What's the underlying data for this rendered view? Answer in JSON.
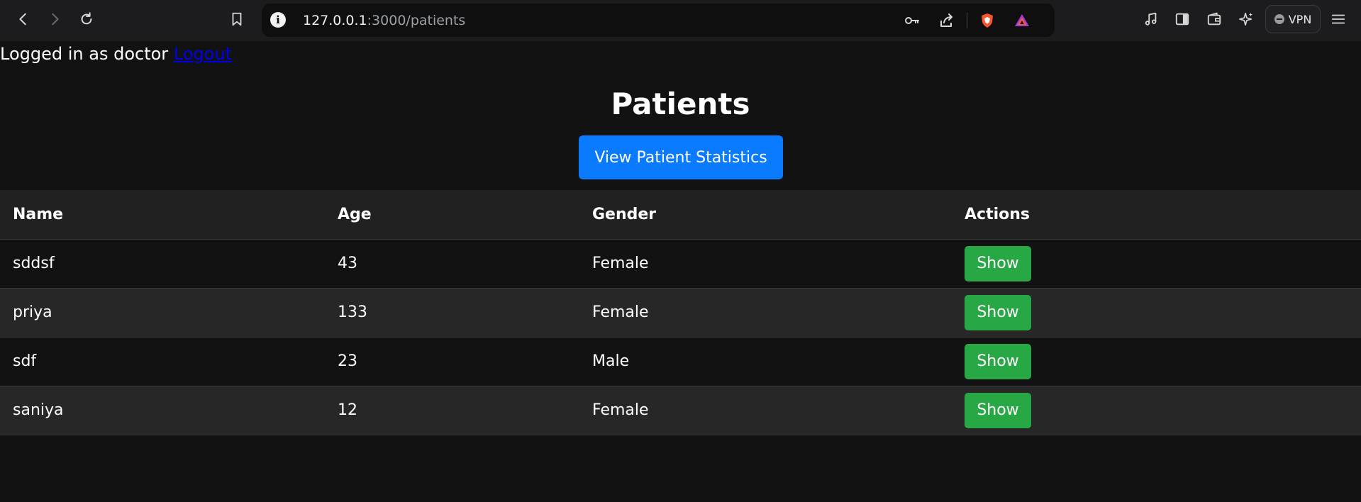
{
  "browser": {
    "url_host": "127.0.0.1",
    "url_path": ":3000/patients",
    "vpn_label": "VPN",
    "icons": [
      "back-icon",
      "forward-icon",
      "reload-icon",
      "bookmark-icon",
      "site-info-icon",
      "key-icon",
      "share-icon",
      "brave-shield-icon",
      "brave-rewards-icon",
      "media-icon",
      "sidebar-icon",
      "wallet-icon",
      "leo-ai-icon",
      "menu-icon"
    ]
  },
  "session": {
    "logged_in_text": "Logged in as doctor",
    "logout_label": "Logout"
  },
  "page": {
    "title": "Patients",
    "stats_button": "View Patient Statistics"
  },
  "table": {
    "headers": [
      "Name",
      "Age",
      "Gender",
      "Actions"
    ],
    "rows": [
      {
        "name": "sddsf",
        "age": "43",
        "gender": "Female",
        "action": "Show"
      },
      {
        "name": "priya",
        "age": "133",
        "gender": "Female",
        "action": "Show"
      },
      {
        "name": "sdf",
        "age": "23",
        "gender": "Male",
        "action": "Show"
      },
      {
        "name": "saniya",
        "age": "12",
        "gender": "Female",
        "action": "Show"
      }
    ]
  },
  "colors": {
    "background": "#121212",
    "primary_button": "#0a7bff",
    "success_button": "#28a745",
    "link": "#0000ee"
  }
}
